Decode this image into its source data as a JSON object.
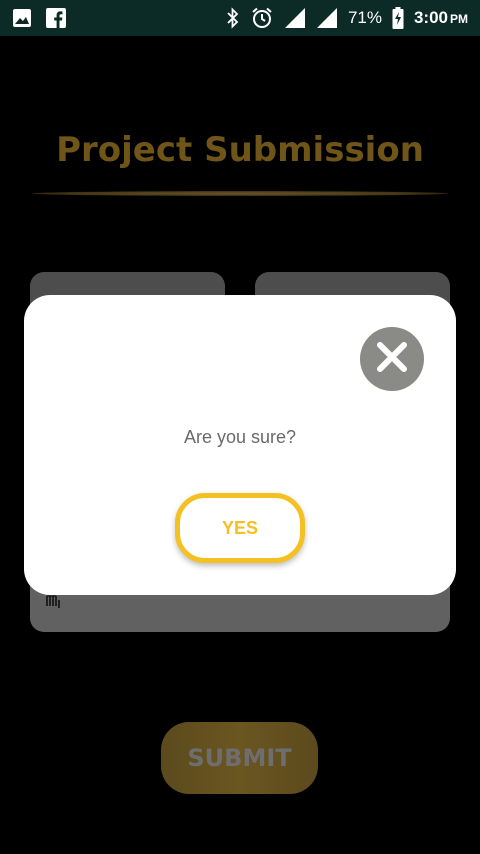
{
  "status_bar": {
    "battery": "71%",
    "time": "3:00",
    "ampm": "PM",
    "icons": [
      "image-icon",
      "facebook-icon",
      "bluetooth-icon",
      "alarm-icon",
      "signal-icon",
      "signal-icon",
      "battery-charging-icon"
    ]
  },
  "page": {
    "title": "Project Submission",
    "submit_label": "SUBMIT"
  },
  "dialog": {
    "message": "Are you sure?",
    "yes_label": "YES",
    "close_icon": "close-icon"
  },
  "colors": {
    "title_gold": "#6f5517",
    "accent_yellow": "#f5c021",
    "status_bar_bg": "#0c2a26",
    "close_circle": "#8a8a86"
  }
}
